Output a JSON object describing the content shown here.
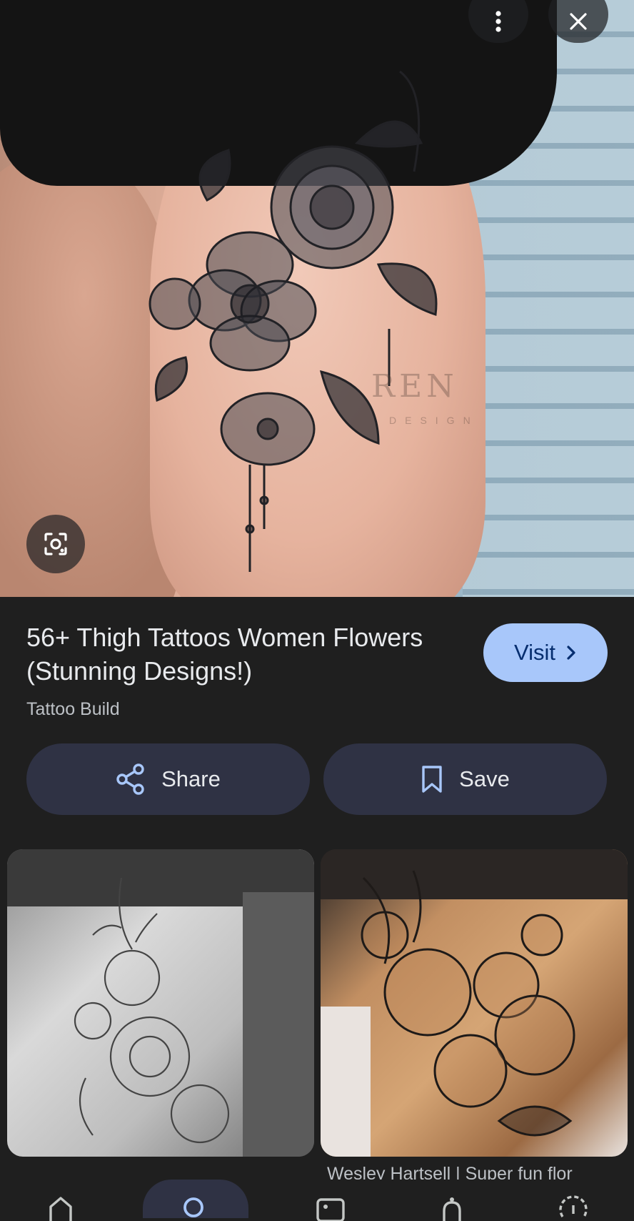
{
  "header": {
    "more_icon": "more-vert-icon",
    "close_icon": "close-icon",
    "lens_icon": "google-lens-icon"
  },
  "hero": {
    "watermark_text": "REN",
    "watermark_sub": "DESIGN"
  },
  "result": {
    "title": "56+ Thigh Tattoos Women Flowers (Stunning Designs!)",
    "source": "Tattoo Build",
    "visit_label": "Visit",
    "visit_icon": "chevron-right-icon"
  },
  "actions": {
    "share_label": "Share",
    "share_icon": "share-icon",
    "save_label": "Save",
    "save_icon": "bookmark-icon"
  },
  "related": {
    "items": [
      {
        "caption": ""
      },
      {
        "caption": "Wesley Hartsell | Super fun flor"
      }
    ]
  },
  "bottom_nav": {
    "items": [
      {
        "icon": "home-icon"
      },
      {
        "icon": "search-icon",
        "active": true
      },
      {
        "icon": "collections-icon"
      },
      {
        "icon": "notifications-icon"
      },
      {
        "icon": "history-icon"
      }
    ]
  },
  "colors": {
    "background": "#1f1f1f",
    "visit_bg": "#a8c7fa",
    "action_bg": "#2f3244",
    "accent_icon": "#a8c7fa"
  }
}
